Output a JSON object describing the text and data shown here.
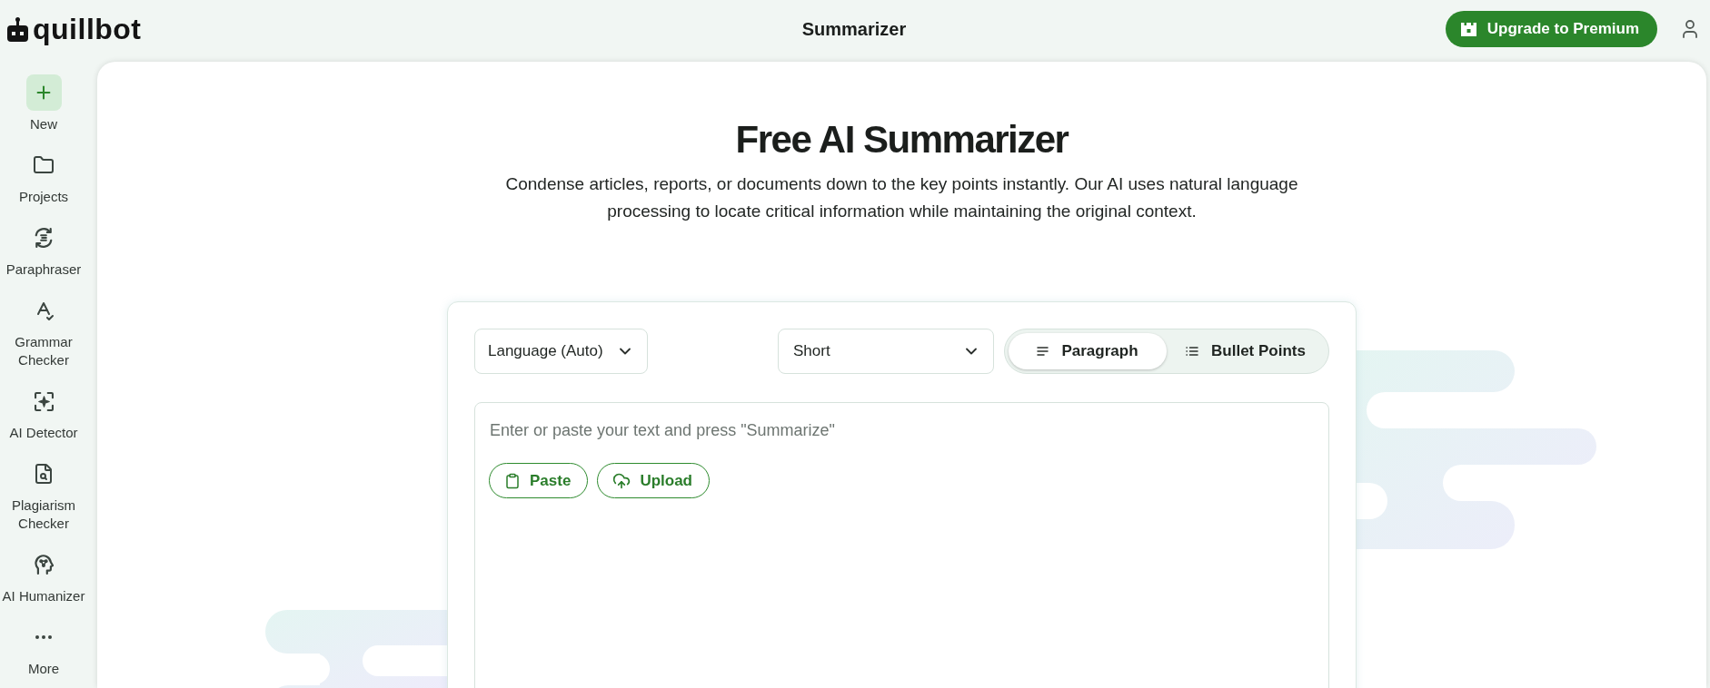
{
  "header": {
    "logo": "quillbot",
    "title": "Summarizer",
    "upgrade_button": "Upgrade to Premium"
  },
  "sidebar": {
    "items": [
      {
        "label": "New",
        "kind": "create"
      },
      {
        "label": "Projects",
        "kind": "tool"
      },
      {
        "label": "Paraphraser",
        "kind": "tool"
      },
      {
        "label": "Grammar Checker",
        "kind": "tool"
      },
      {
        "label": "AI Detector",
        "kind": "tool"
      },
      {
        "label": "Plagiarism Checker",
        "kind": "tool"
      },
      {
        "label": "AI Humanizer",
        "kind": "tool"
      },
      {
        "label": "More",
        "kind": "tool"
      }
    ]
  },
  "hero": {
    "title": "Free AI Summarizer",
    "description": "Condense articles, reports, or documents down to the key points instantly. Our AI uses natural language processing to locate critical information while maintaining the original context."
  },
  "summarizer": {
    "language_select": {
      "value": "Language (Auto)"
    },
    "length_select": {
      "value": "Short"
    },
    "modes": [
      {
        "label": "Paragraph",
        "selected": true
      },
      {
        "label": "Bullet Points",
        "selected": false
      }
    ],
    "input": {
      "placeholder": "Enter or paste your text and press \"Summarize\""
    },
    "actions": [
      "Paste",
      "Upload"
    ]
  }
}
